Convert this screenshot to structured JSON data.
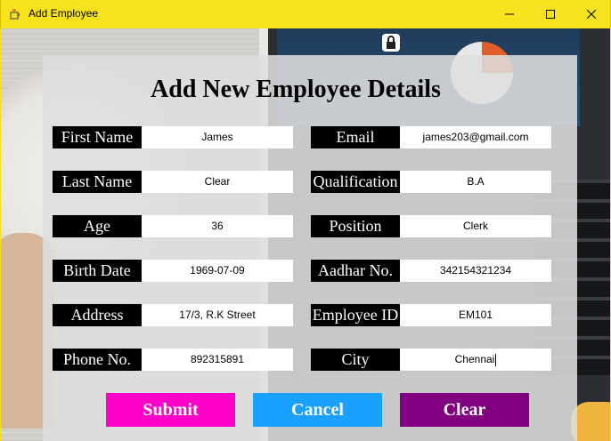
{
  "window": {
    "title": "Add Employee",
    "titlebar_color": "#f8e21c"
  },
  "icons": {
    "app": "java-coffee-icon",
    "minimize": "minimize-icon",
    "maximize": "maximize-icon",
    "close": "close-icon"
  },
  "form": {
    "title": "Add New Employee Details",
    "left_fields": [
      {
        "label": "First Name",
        "value": "James"
      },
      {
        "label": "Last Name",
        "value": "Clear"
      },
      {
        "label": "Age",
        "value": "36"
      },
      {
        "label": "Birth Date",
        "value": "1969-07-09"
      },
      {
        "label": "Address",
        "value": "17/3, R.K Street"
      },
      {
        "label": "Phone No.",
        "value": "892315891"
      }
    ],
    "right_fields": [
      {
        "label": "Email",
        "value": "james203@gmail.com"
      },
      {
        "label": "Qualification",
        "value": "B.A"
      },
      {
        "label": "Position",
        "value": "Clerk"
      },
      {
        "label": "Aadhar No.",
        "value": "342154321234"
      },
      {
        "label": "Employee ID",
        "value": "EM101"
      },
      {
        "label": "City",
        "value": "Chennai"
      }
    ]
  },
  "buttons": {
    "submit": {
      "label": "Submit",
      "color": "#ff00c8"
    },
    "cancel": {
      "label": "Cancel",
      "color": "#1aa0ff"
    },
    "clear": {
      "label": "Clear",
      "color": "#800080"
    }
  }
}
